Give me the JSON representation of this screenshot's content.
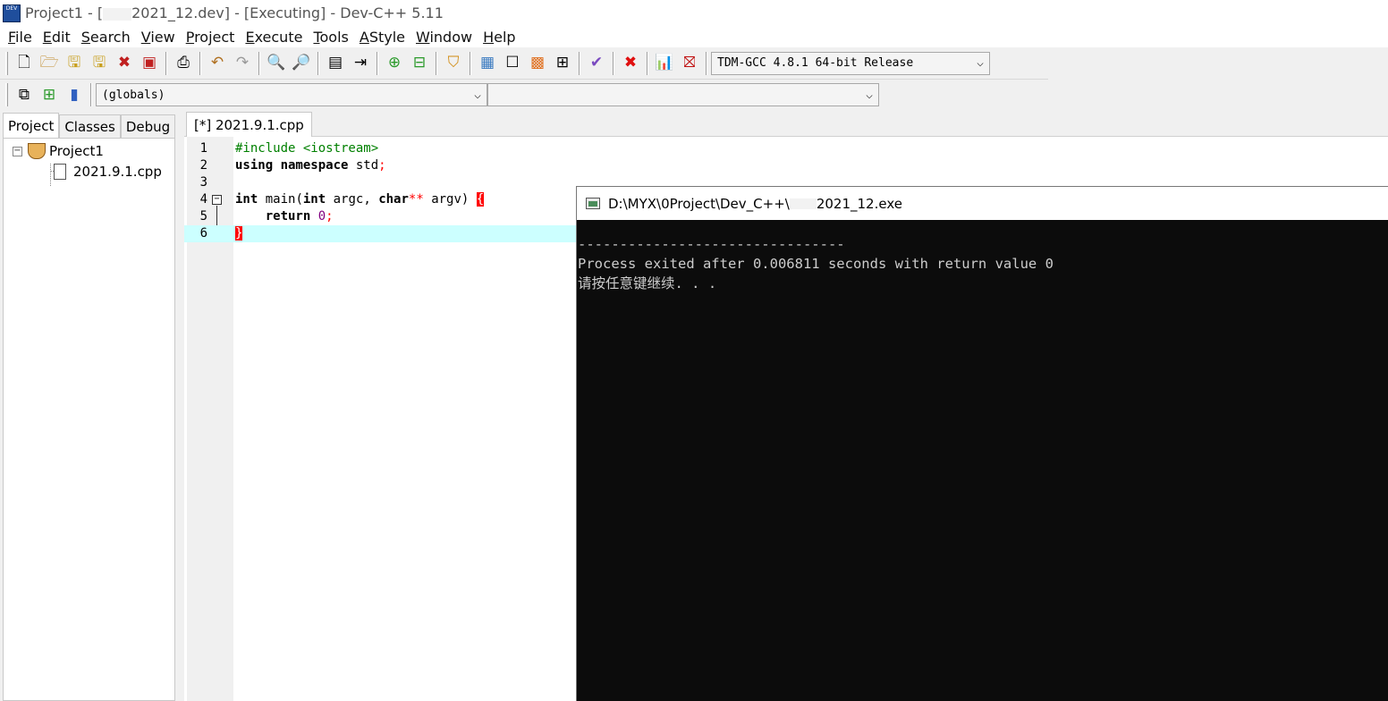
{
  "window": {
    "title_prefix": "Project1 - [",
    "title_suffix": "2021_12.dev] - [Executing] - Dev-C++ 5.11",
    "icon_text": "DEV"
  },
  "menu": [
    {
      "u": "F",
      "rest": "ile"
    },
    {
      "u": "E",
      "rest": "dit"
    },
    {
      "u": "S",
      "rest": "earch"
    },
    {
      "u": "V",
      "rest": "iew"
    },
    {
      "u": "P",
      "rest": "roject"
    },
    {
      "u": "E",
      "rest": "xecute"
    },
    {
      "u": "T",
      "rest": "ools"
    },
    {
      "u": "A",
      "rest": "Style"
    },
    {
      "u": "W",
      "rest": "indow"
    },
    {
      "u": "H",
      "rest": "elp"
    }
  ],
  "toolbar": {
    "compiler_select": "TDM-GCC 4.8.1 64-bit Release",
    "globals_select": "(globals)",
    "member_select": ""
  },
  "left_panel": {
    "tabs": [
      "Project",
      "Classes",
      "Debug"
    ],
    "project_name": "Project1",
    "file_name": "2021.9.1.cpp"
  },
  "editor": {
    "tab_label": "[*] 2021.9.1.cpp",
    "line_numbers": [
      "1",
      "2",
      "3",
      "4",
      "5",
      "6"
    ],
    "code": {
      "l1": "#include <iostream>",
      "l2_kw": "using namespace",
      "l2_rest": " std",
      "l2_semi": ";",
      "l4_int": "int",
      "l4_main": " main(",
      "l4_int2": "int",
      "l4_argc": " argc, ",
      "l4_char": "char",
      "l4_stars": "**",
      "l4_argv": " argv) ",
      "l4_brace": "{",
      "l5_return": "return",
      "l5_zero": "0",
      "l5_semi": ";",
      "l6_brace": "}"
    }
  },
  "console": {
    "title_prefix": "D:\\MYX\\0Project\\Dev_C++\\",
    "title_suffix": "2021_12.exe",
    "lines": [
      "--------------------------------",
      "Process exited after 0.006811 seconds with return value 0",
      "请按任意键继续. . ."
    ]
  },
  "colors": {
    "highlight_line": "#ccffff",
    "preprocessor": "#008000",
    "number": "#800080",
    "brace_match": "#ff0000",
    "console_bg": "#0c0c0c",
    "console_fg": "#cccccc"
  }
}
